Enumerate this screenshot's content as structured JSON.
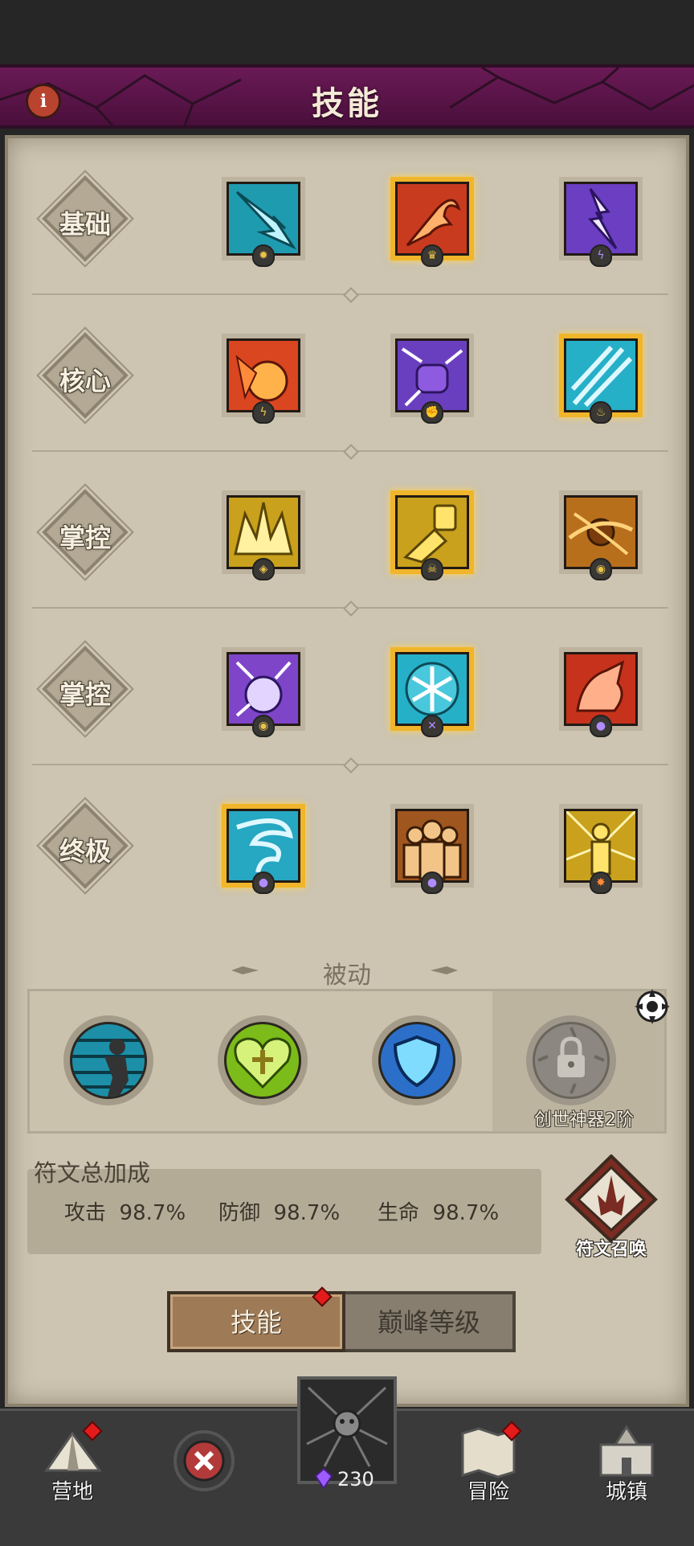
{
  "header": {
    "title": "技能",
    "info_icon": "info-icon"
  },
  "tiers": [
    {
      "label": "基础",
      "skills": [
        {
          "icon": "ice-arrow-icon",
          "color": "#1f9bb0",
          "selected": false,
          "badge": "sun"
        },
        {
          "icon": "fire-claw-icon",
          "color": "#c93b1f",
          "selected": true,
          "badge": "crown"
        },
        {
          "icon": "lightning-icon",
          "color": "#6b3ec2",
          "selected": false,
          "badge": "bolt"
        }
      ]
    },
    {
      "label": "核心",
      "skills": [
        {
          "icon": "fireball-icon",
          "color": "#d9461f",
          "selected": false,
          "badge": "bolt"
        },
        {
          "icon": "thunder-fist-icon",
          "color": "#6a3fbf",
          "selected": false,
          "badge": "fist"
        },
        {
          "icon": "ice-shards-icon",
          "color": "#26b0c8",
          "selected": true,
          "badge": "flame"
        }
      ]
    },
    {
      "label": "掌控",
      "skills": [
        {
          "icon": "golden-crown-icon",
          "color": "#c9a11c",
          "selected": false,
          "badge": "shield"
        },
        {
          "icon": "golden-dash-icon",
          "color": "#c9a11c",
          "selected": true,
          "badge": "skull"
        },
        {
          "icon": "vortex-icon",
          "color": "#b86f1c",
          "selected": false,
          "badge": "eye"
        }
      ]
    },
    {
      "label": "掌控",
      "skills": [
        {
          "icon": "storm-orb-icon",
          "color": "#7e45c9",
          "selected": false,
          "badge": "eye"
        },
        {
          "icon": "snowflake-icon",
          "color": "#26b0c8",
          "selected": true,
          "badge": "cross"
        },
        {
          "icon": "fire-beast-icon",
          "color": "#c7321c",
          "selected": false,
          "badge": "drop"
        }
      ]
    },
    {
      "label": "终极",
      "skills": [
        {
          "icon": "ice-tornado-icon",
          "color": "#26a7c2",
          "selected": true,
          "badge": "drop"
        },
        {
          "icon": "clone-army-icon",
          "color": "#a0561f",
          "selected": false,
          "badge": "drop"
        },
        {
          "icon": "golden-avatar-icon",
          "color": "#c9a11c",
          "selected": false,
          "badge": "star"
        }
      ]
    }
  ],
  "passive": {
    "title": "被动",
    "items": [
      {
        "icon": "sprint-icon",
        "color": "#1d8fa8"
      },
      {
        "icon": "heart-heal-icon",
        "color": "#7cbc1a"
      },
      {
        "icon": "shield-icon",
        "color": "#2c6fc9"
      }
    ],
    "locked_label": "创世神器2阶",
    "lock_icon": "lock-icon"
  },
  "rune": {
    "title": "符文总加成",
    "stats": [
      {
        "label": "攻击",
        "value": "98.7%"
      },
      {
        "label": "防御",
        "value": "98.7%"
      },
      {
        "label": "生命",
        "value": "98.7%"
      }
    ],
    "summon_label": "符文召唤"
  },
  "tabs": {
    "active": "技能",
    "other": "巅峰等级"
  },
  "nav": {
    "camp": "营地",
    "adventure": "冒险",
    "town": "城镇",
    "gem_count": "230"
  }
}
